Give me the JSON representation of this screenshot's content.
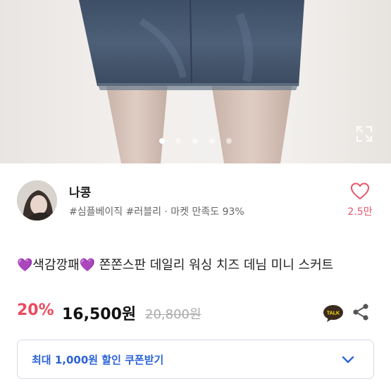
{
  "product_image": {
    "alt": "",
    "page_count": 5,
    "current_page": 1
  },
  "icons": {
    "expand": "expand-icon",
    "heart": "heart-icon",
    "talk": "kakaotalk-icon",
    "share": "share-icon",
    "chevron": "chevron-down-icon"
  },
  "seller": {
    "name": "나콩",
    "tags": "#심플베이직 #러블리 · 마켓 만족도 93%",
    "likes": "2.5만"
  },
  "product": {
    "title": "💜색감깡패💜 쫀쫀스판 데일리 워싱 치즈 데님 미니 스커트",
    "discount": "20%",
    "price": "16,500원",
    "original_price": "20,800원"
  },
  "talk_badge": "TALK",
  "coupon": {
    "label": "최대 1,000원 할인 쿠폰받기"
  },
  "colors": {
    "accent": "#ea4b5f",
    "coupon_blue": "#2c63d8",
    "heart": "#e9546b"
  }
}
